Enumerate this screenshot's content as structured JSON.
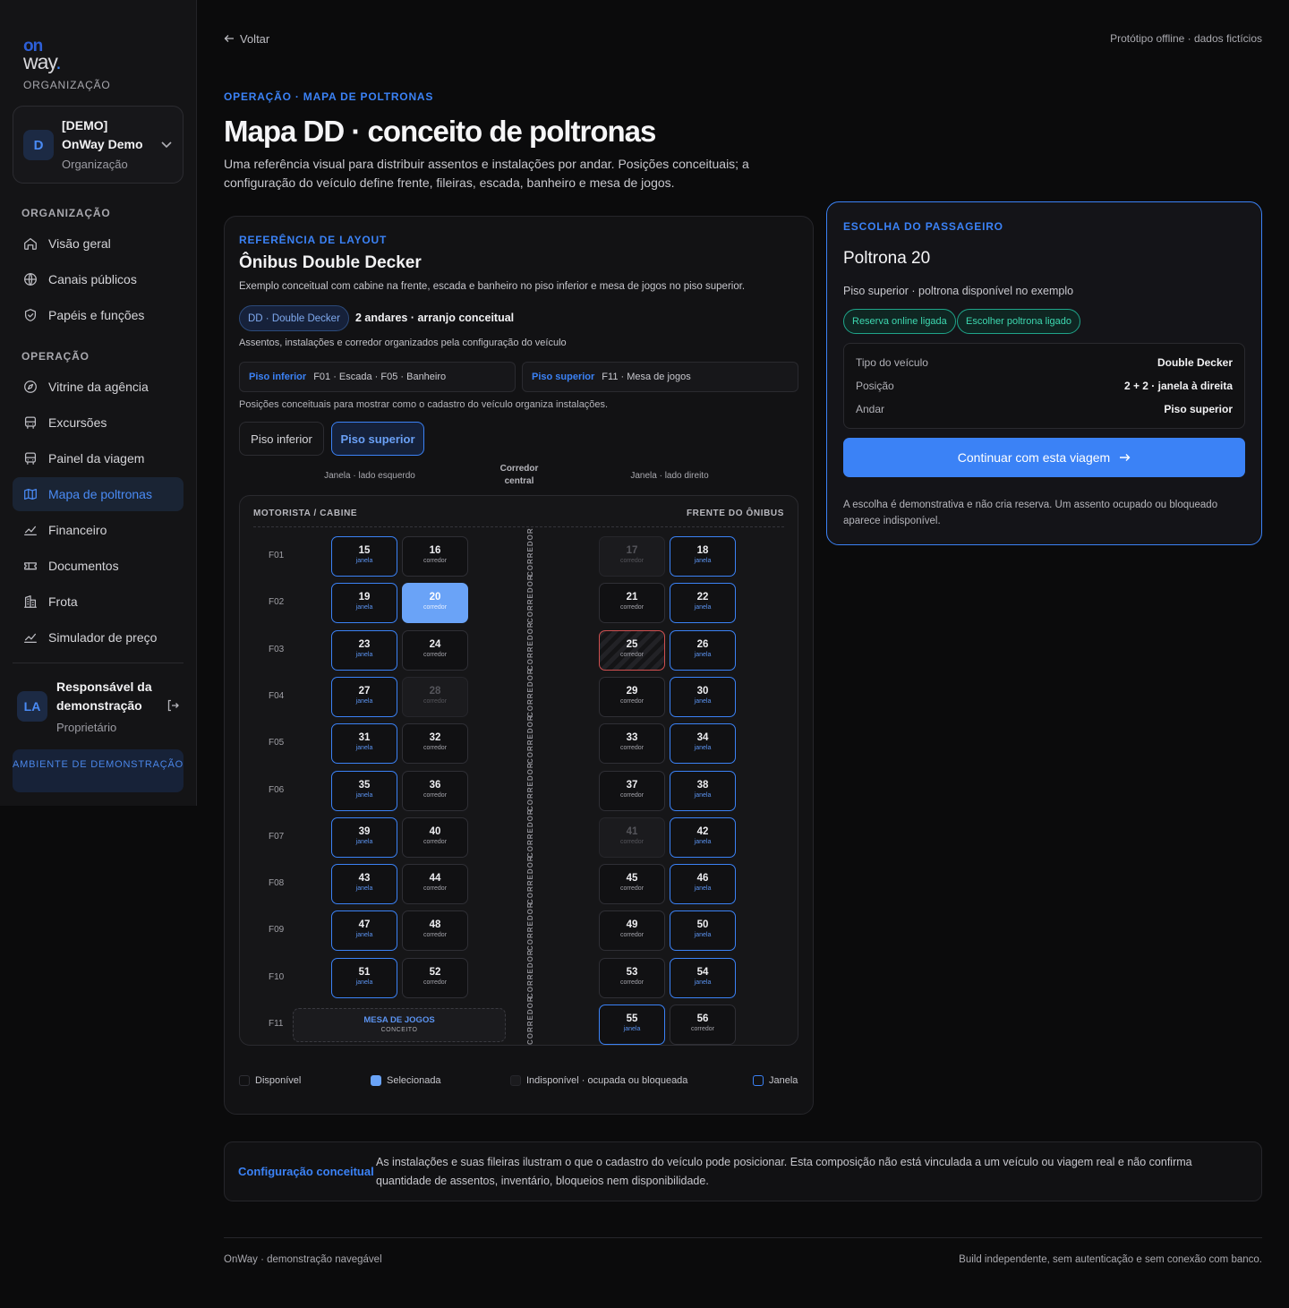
{
  "brand": {
    "logo_top": "on",
    "logo_bottom": "way",
    "logo_dot": ".",
    "caption": "ORGANIZAÇÃO"
  },
  "org_card": {
    "avatar": "D",
    "name": "[DEMO] OnWay Demo",
    "sub": "Organização"
  },
  "nav": {
    "section1": "ORGANIZAÇÃO",
    "items1": [
      {
        "label": "Visão geral",
        "icon": "home-icon"
      },
      {
        "label": "Canais públicos",
        "icon": "globe-icon"
      },
      {
        "label": "Papéis e funções",
        "icon": "shield-icon"
      }
    ],
    "section2": "OPERAÇÃO",
    "items2": [
      {
        "label": "Vitrine da agência",
        "icon": "compass-icon"
      },
      {
        "label": "Excursões",
        "icon": "bus-icon"
      },
      {
        "label": "Painel da viagem",
        "icon": "bus-icon"
      },
      {
        "label": "Mapa de poltronas",
        "icon": "map-icon",
        "active": true
      },
      {
        "label": "Financeiro",
        "icon": "chart-line-icon"
      },
      {
        "label": "Documentos",
        "icon": "ticket-icon"
      },
      {
        "label": "Frota",
        "icon": "building-icon"
      },
      {
        "label": "Simulador de preço",
        "icon": "chart-line-icon"
      }
    ]
  },
  "user": {
    "avatar": "LA",
    "name": "Responsável da demonstração",
    "role": "Proprietário"
  },
  "env_badge": "AMBIENTE DE DEMONSTRAÇÃO",
  "topbar": {
    "back": "Voltar",
    "note": "Protótipo offline · dados fictícios"
  },
  "header": {
    "eyebrow": "OPERAÇÃO · MAPA DE POLTRONAS",
    "title": "Mapa DD · conceito de poltronas",
    "description": "Uma referência visual para distribuir assentos e instalações por andar. Posições conceituais; a configuração do veículo define frente, fileiras, escada, banheiro e mesa de jogos."
  },
  "layout_card": {
    "eyebrow": "REFERÊNCIA DE LAYOUT",
    "title": "Ônibus Double Decker",
    "description": "Exemplo conceitual com cabine na frente, escada e banheiro no piso inferior e mesa de jogos no piso superior.",
    "pill": "DD · Double Decker",
    "arrangement": "2 andares · arranjo conceitual",
    "sub": "Assentos, instalações e corredor organizados pela configuração do veículo",
    "floor_lower": {
      "label": "Piso inferior",
      "text": "F01 · Escada · F05 · Banheiro"
    },
    "floor_upper": {
      "label": "Piso superior",
      "text": "F11 · Mesa de jogos"
    },
    "note": "Posições conceituais para mostrar como o cadastro do veículo organiza instalações.",
    "tabs": [
      "Piso inferior",
      "Piso superior"
    ],
    "active_tab": 1,
    "col_left": "Janela · lado esquerdo",
    "col_center": "Corredor central",
    "col_right": "Janela · lado direito"
  },
  "seat_map": {
    "header_left": "MOTORISTA / CABINE",
    "header_right": "FRENTE DO ÔNIBUS",
    "corridor": "CORREDOR",
    "window_label": "janela",
    "aisle_label": "corredor",
    "rows": [
      {
        "label": "F01",
        "seats": [
          {
            "n": "15",
            "t": "janela",
            "s": "window"
          },
          {
            "n": "16",
            "t": "corredor",
            "s": "available"
          },
          {
            "n": "17",
            "t": "corredor",
            "s": "disabled"
          },
          {
            "n": "18",
            "t": "janela",
            "s": "window"
          }
        ]
      },
      {
        "label": "F02",
        "seats": [
          {
            "n": "19",
            "t": "janela",
            "s": "window"
          },
          {
            "n": "20",
            "t": "corredor",
            "s": "selected"
          },
          {
            "n": "21",
            "t": "corredor",
            "s": "available"
          },
          {
            "n": "22",
            "t": "janela",
            "s": "window"
          }
        ]
      },
      {
        "label": "F03",
        "seats": [
          {
            "n": "23",
            "t": "janela",
            "s": "window"
          },
          {
            "n": "24",
            "t": "corredor",
            "s": "available"
          },
          {
            "n": "25",
            "t": "corredor",
            "s": "blocked"
          },
          {
            "n": "26",
            "t": "janela",
            "s": "window"
          }
        ]
      },
      {
        "label": "F04",
        "seats": [
          {
            "n": "27",
            "t": "janela",
            "s": "window"
          },
          {
            "n": "28",
            "t": "corredor",
            "s": "disabled"
          },
          {
            "n": "29",
            "t": "corredor",
            "s": "available"
          },
          {
            "n": "30",
            "t": "janela",
            "s": "window"
          }
        ]
      },
      {
        "label": "F05",
        "seats": [
          {
            "n": "31",
            "t": "janela",
            "s": "window"
          },
          {
            "n": "32",
            "t": "corredor",
            "s": "available"
          },
          {
            "n": "33",
            "t": "corredor",
            "s": "available"
          },
          {
            "n": "34",
            "t": "janela",
            "s": "window"
          }
        ]
      },
      {
        "label": "F06",
        "seats": [
          {
            "n": "35",
            "t": "janela",
            "s": "window"
          },
          {
            "n": "36",
            "t": "corredor",
            "s": "available"
          },
          {
            "n": "37",
            "t": "corredor",
            "s": "available"
          },
          {
            "n": "38",
            "t": "janela",
            "s": "window"
          }
        ]
      },
      {
        "label": "F07",
        "seats": [
          {
            "n": "39",
            "t": "janela",
            "s": "window"
          },
          {
            "n": "40",
            "t": "corredor",
            "s": "available"
          },
          {
            "n": "41",
            "t": "corredor",
            "s": "disabled"
          },
          {
            "n": "42",
            "t": "janela",
            "s": "window"
          }
        ]
      },
      {
        "label": "F08",
        "seats": [
          {
            "n": "43",
            "t": "janela",
            "s": "window"
          },
          {
            "n": "44",
            "t": "corredor",
            "s": "available"
          },
          {
            "n": "45",
            "t": "corredor",
            "s": "available"
          },
          {
            "n": "46",
            "t": "janela",
            "s": "window"
          }
        ]
      },
      {
        "label": "F09",
        "seats": [
          {
            "n": "47",
            "t": "janela",
            "s": "window"
          },
          {
            "n": "48",
            "t": "corredor",
            "s": "available"
          },
          {
            "n": "49",
            "t": "corredor",
            "s": "available"
          },
          {
            "n": "50",
            "t": "janela",
            "s": "window"
          }
        ]
      },
      {
        "label": "F10",
        "seats": [
          {
            "n": "51",
            "t": "janela",
            "s": "window"
          },
          {
            "n": "52",
            "t": "corredor",
            "s": "available"
          },
          {
            "n": "53",
            "t": "corredor",
            "s": "available"
          },
          {
            "n": "54",
            "t": "janela",
            "s": "window"
          }
        ]
      },
      {
        "label": "F11",
        "games": {
          "title": "MESA DE JOGOS",
          "sub": "CONCEITO"
        },
        "seats": [
          null,
          null,
          {
            "n": "55",
            "t": "janela",
            "s": "window"
          },
          {
            "n": "56",
            "t": "corredor",
            "s": "available"
          }
        ]
      }
    ]
  },
  "legend": [
    {
      "label": "Disponível",
      "kind": "available"
    },
    {
      "label": "Selecionada",
      "kind": "selected"
    },
    {
      "label": "Indisponível · ocupada ou bloqueada",
      "kind": "disabled"
    },
    {
      "label": "Janela",
      "kind": "window"
    }
  ],
  "passenger": {
    "eyebrow": "ESCOLHA DO PASSAGEIRO",
    "title": "Poltrona 20",
    "sub": "Piso superior · poltrona disponível no exemplo",
    "badges": [
      "Reserva online ligada",
      "Escolher poltrona ligado"
    ],
    "info": [
      {
        "label": "Tipo do veículo",
        "value": "Double Decker"
      },
      {
        "label": "Posição",
        "value": "2 + 2 · janela à direita"
      },
      {
        "label": "Andar",
        "value": "Piso superior"
      }
    ],
    "cta": "Continuar com esta viagem",
    "note": "A escolha é demonstrativa e não cria reserva. Um assento ocupado ou bloqueado aparece indisponível."
  },
  "concept": {
    "label": "Configuração conceitual",
    "text": "As instalações e suas fileiras ilustram o que o cadastro do veículo pode posicionar. Esta composição não está vinculada a um veículo ou viagem real e não confirma quantidade de assentos, inventário, bloqueios nem disponibilidade."
  },
  "footer": {
    "left": "OnWay · demonstração navegável",
    "right": "Build independente, sem autenticação e sem conexão com banco."
  },
  "colors": {
    "accent": "#3b82f6",
    "selected": "#6aa3f7",
    "blocked": "#d05050",
    "badge_green": "#3dd8b0"
  }
}
